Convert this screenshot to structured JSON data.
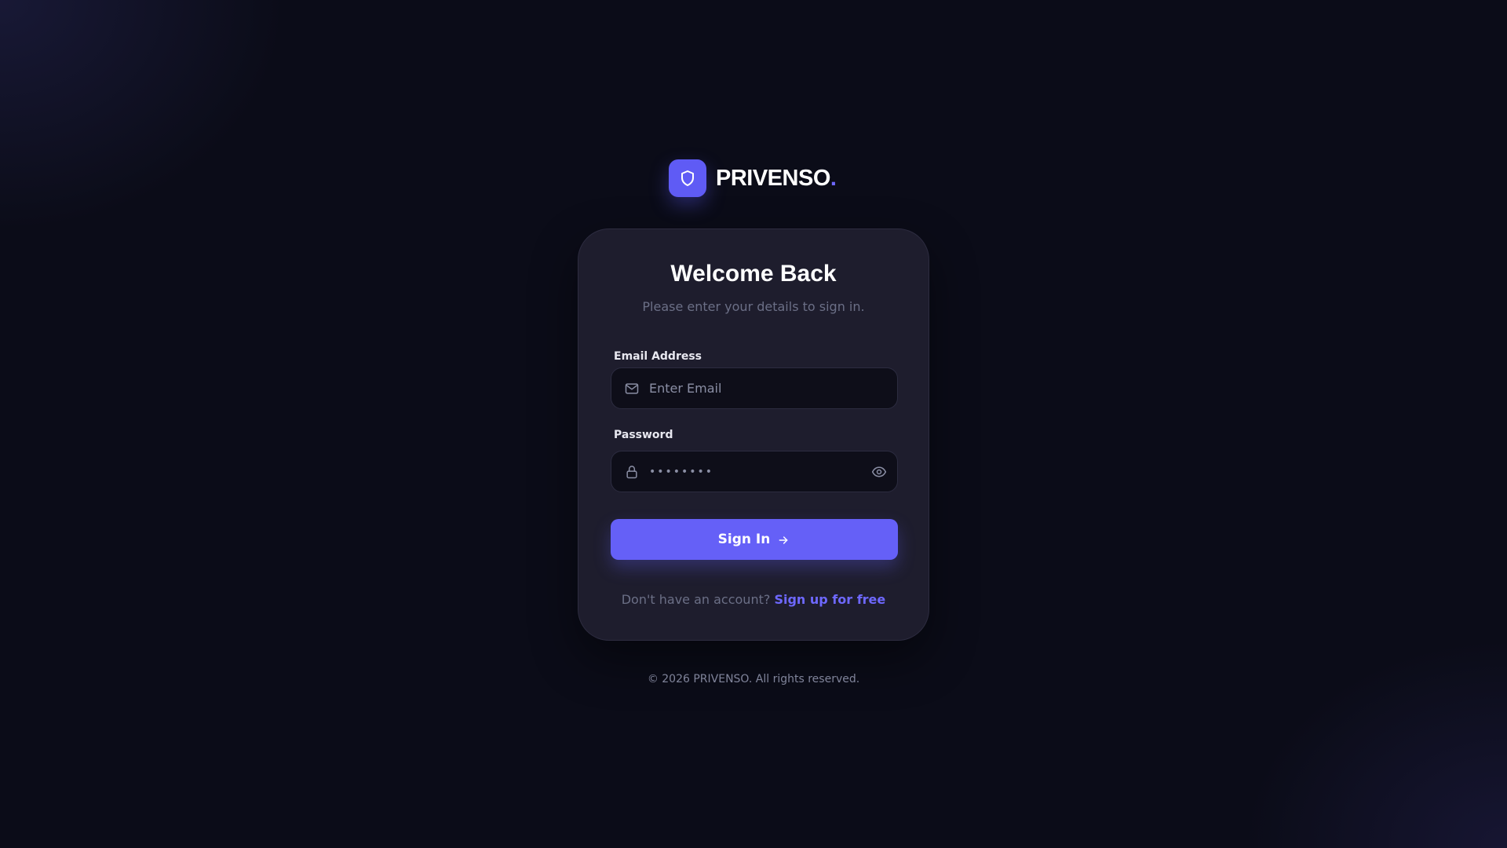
{
  "brand": {
    "name": "PRIVENSO",
    "dot": ".",
    "logo_icon": "shield-icon",
    "accent_color": "#5f5bf5"
  },
  "card": {
    "title": "Welcome Back",
    "subtitle": "Please enter your details to sign in."
  },
  "email": {
    "label": "Email Address",
    "placeholder": "Enter Email",
    "value": "",
    "icon": "mail-icon"
  },
  "password": {
    "label": "Password",
    "masked_value": "••••••••",
    "icon": "lock-icon",
    "toggle_icon": "eye-icon"
  },
  "signin": {
    "label": "Sign In",
    "icon": "arrow-right-icon",
    "color": "#6560f7"
  },
  "signup": {
    "prompt": "Don't have an account?",
    "link": "Sign up for free",
    "link_color": "#6e68ff"
  },
  "footer": {
    "text": "© 2026 PRIVENSO. All rights reserved."
  }
}
